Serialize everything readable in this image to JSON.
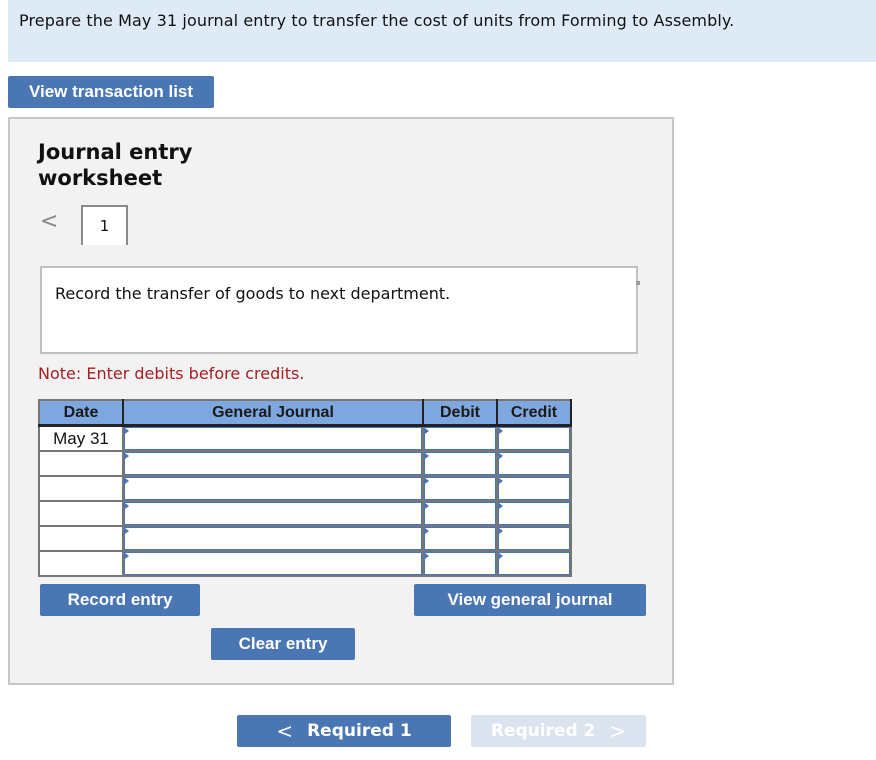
{
  "prompt": {
    "text": "Prepare the May 31 journal entry to transfer the cost of units from Forming to Assembly."
  },
  "buttons": {
    "view_transaction_list": "View transaction list",
    "record_entry": "Record entry",
    "clear_entry": "Clear entry",
    "view_general_journal": "View general journal"
  },
  "worksheet": {
    "title": "Journal entry worksheet",
    "pager": {
      "prev_icon": "chevron-left-icon",
      "prev_glyph": "<",
      "current": "1"
    },
    "description": "Record the transfer of goods to next department.",
    "note": "Note: Enter debits before credits.",
    "table": {
      "headers": [
        "Date",
        "General Journal",
        "Debit",
        "Credit"
      ],
      "rows": [
        {
          "date": "May 31",
          "account": "",
          "debit": "",
          "credit": ""
        },
        {
          "date": "",
          "account": "",
          "debit": "",
          "credit": ""
        },
        {
          "date": "",
          "account": "",
          "debit": "",
          "credit": ""
        },
        {
          "date": "",
          "account": "",
          "debit": "",
          "credit": ""
        },
        {
          "date": "",
          "account": "",
          "debit": "",
          "credit": ""
        },
        {
          "date": "",
          "account": "",
          "debit": "",
          "credit": ""
        }
      ]
    }
  },
  "navigation": {
    "prev": {
      "label": "Required 1",
      "icon": "chevron-left-icon",
      "glyph": "<",
      "enabled": true
    },
    "next": {
      "label": "Required 2",
      "icon": "chevron-right-icon",
      "glyph": ">",
      "enabled": false
    }
  },
  "colors": {
    "prompt_bg": "#deebf7",
    "button_blue": "#4a76b4",
    "header_blue": "#7ea7df",
    "note_red": "#a51e22",
    "panel_bg": "#f2f2f2",
    "disabled_button": "#dbe3ef"
  }
}
